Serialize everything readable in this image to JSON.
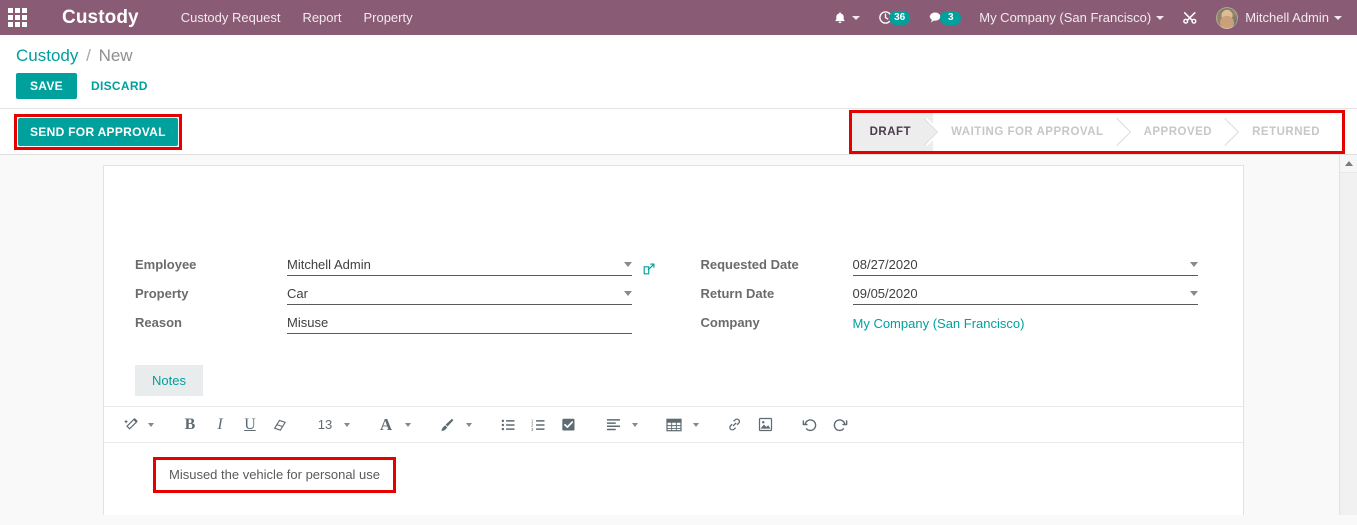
{
  "navbar": {
    "apps_icon": "apps-grid-icon",
    "brand": "Custody",
    "menu": [
      {
        "label": "Custody Request"
      },
      {
        "label": "Report"
      },
      {
        "label": "Property"
      }
    ],
    "bell_icon": "bell-icon",
    "activity_icon": "clock-activity-icon",
    "activity_count": "36",
    "messages_icon": "chat-bubble-icon",
    "messages_count": "3",
    "company": "My Company (San Francisco)",
    "tools_icon": "wrench-screwdriver-icon",
    "user_name": "Mitchell Admin",
    "avatar_icon": "user-avatar"
  },
  "breadcrumb": {
    "root": "Custody",
    "separator": "/",
    "current": "New"
  },
  "control_panel": {
    "save_label": "SAVE",
    "discard_label": "DISCARD"
  },
  "statusbar_row": {
    "send_for_approval_label": "SEND FOR APPROVAL",
    "stages": [
      {
        "label": "DRAFT",
        "active": true
      },
      {
        "label": "WAITING FOR APPROVAL",
        "active": false
      },
      {
        "label": "APPROVED",
        "active": false
      },
      {
        "label": "RETURNED",
        "active": false
      }
    ]
  },
  "form": {
    "left": [
      {
        "label": "Employee",
        "value": "Mitchell Admin",
        "widget": "many2one",
        "has_caret": true,
        "has_external_link": true
      },
      {
        "label": "Property",
        "value": "Car",
        "widget": "many2one",
        "has_caret": true,
        "has_external_link": false
      },
      {
        "label": "Reason",
        "value": "Misuse",
        "widget": "char",
        "has_caret": false,
        "has_external_link": false
      }
    ],
    "right": [
      {
        "label": "Requested Date",
        "value": "08/27/2020",
        "widget": "date",
        "has_caret": true,
        "has_external_link": false
      },
      {
        "label": "Return Date",
        "value": "09/05/2020",
        "widget": "date",
        "has_caret": true,
        "has_external_link": false
      },
      {
        "label": "Company",
        "value": "My Company (San Francisco)",
        "widget": "link",
        "has_caret": false,
        "has_external_link": false
      }
    ]
  },
  "notebook": {
    "tabs": [
      {
        "label": "Notes",
        "active": true
      }
    ],
    "toolbar": {
      "style_icon": "magic-wand-icon",
      "bold_label": "B",
      "italic_label": "I",
      "underline_label": "U",
      "eraser_icon": "eraser-icon",
      "font_size_value": "13",
      "font_color_label": "A",
      "background_color_icon": "paint-brush-icon",
      "unordered_list_icon": "bullet-list-icon",
      "ordered_list_icon": "numbered-list-icon",
      "checklist_icon": "checklist-icon",
      "align_icon": "align-left-icon",
      "table_icon": "table-icon",
      "link_icon": "link-icon",
      "image_icon": "image-icon",
      "undo_icon": "undo-icon",
      "redo_icon": "redo-icon"
    },
    "note_text": "Misused the vehicle for personal use"
  },
  "colors": {
    "navbar_purple": "#8a5b75",
    "accent_teal": "#00a09d",
    "annotation_red": "#e60000",
    "stage_active_bg": "#ededed"
  }
}
